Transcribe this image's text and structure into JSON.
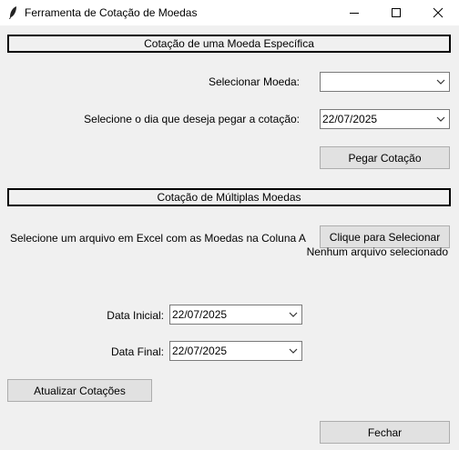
{
  "window": {
    "title": "Ferramenta de Cotação de Moedas",
    "icon": "feather-icon"
  },
  "single": {
    "header": "Cotação de uma Moeda Específica",
    "currency_label": "Selecionar Moeda:",
    "currency_value": "",
    "date_label": "Selecione o dia que deseja pegar a cotação:",
    "date_value": "22/07/2025",
    "get_button": "Pegar Cotação"
  },
  "multiple": {
    "header": "Cotação de Múltiplas Moedas",
    "file_label": "Selecione um arquivo em Excel com as Moedas na Coluna A",
    "select_button": "Clique para Selecionar",
    "file_status": "Nenhum arquivo selecionado",
    "start_label": "Data Inicial:",
    "start_value": "22/07/2025",
    "end_label": "Data Final:",
    "end_value": "22/07/2025",
    "update_button": "Atualizar Cotações"
  },
  "footer": {
    "close_button": "Fechar"
  }
}
